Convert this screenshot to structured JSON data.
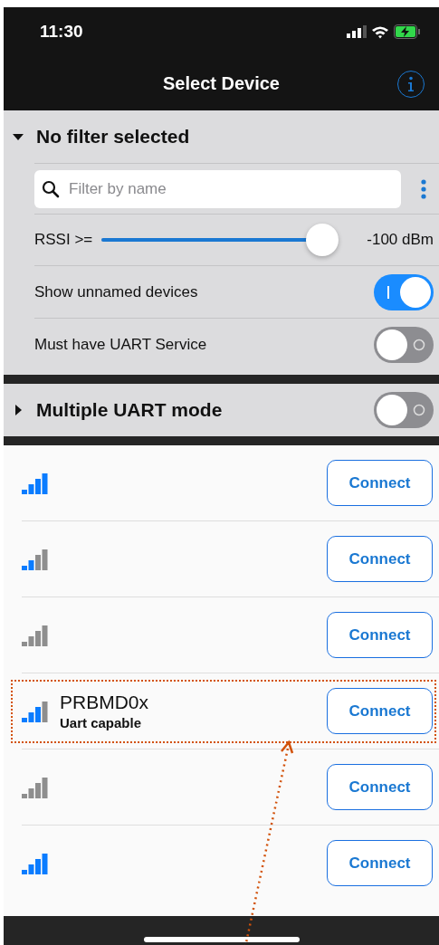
{
  "status_bar": {
    "time": "11:30"
  },
  "nav": {
    "title": "Select Device"
  },
  "filter_panel": {
    "title": "No filter selected",
    "expanded": true,
    "search": {
      "placeholder": "Filter by name"
    },
    "rssi": {
      "label": "RSSI >=",
      "level": 0.93,
      "reading": "-100 dBm"
    },
    "options": [
      {
        "label": "Show unnamed devices",
        "on": true
      },
      {
        "label": "Must have UART Service",
        "on": false
      }
    ]
  },
  "multi_uart": {
    "title": "Multiple UART mode",
    "expanded": false,
    "on": false
  },
  "devices": [
    {
      "kind": "strong",
      "button": "Connect",
      "highlighted": false
    },
    {
      "kind": "fair",
      "button": "Connect",
      "highlighted": false
    },
    {
      "kind": "none",
      "button": "Connect",
      "highlighted": false
    },
    {
      "kind": "good",
      "name": "PRBMD0x",
      "subtitle": "Uart capable",
      "button": "Connect",
      "highlighted": true
    },
    {
      "kind": "none",
      "button": "Connect",
      "highlighted": false
    },
    {
      "kind": "strong",
      "button": "Connect",
      "highlighted": false
    }
  ]
}
